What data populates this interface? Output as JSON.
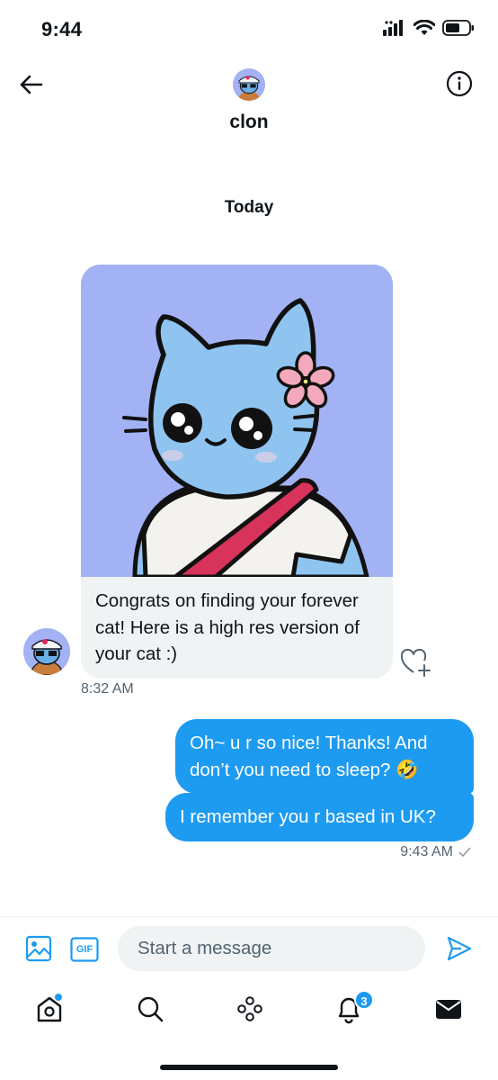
{
  "status_bar": {
    "time": "9:44"
  },
  "header": {
    "name": "clon"
  },
  "date_separator": "Today",
  "incoming_message": {
    "text": "Congrats on finding your forever cat! Here is a high res version of your cat :)",
    "time": "8:32 AM"
  },
  "outgoing_messages": [
    {
      "text": "Oh~ u r so nice! Thanks! And don’t you need to sleep? 🤣"
    },
    {
      "text": "I remember you r based in UK?"
    }
  ],
  "outgoing_time": "9:43 AM",
  "composer": {
    "placeholder": "Start a message",
    "gif_label": "GIF"
  },
  "bottom_nav": {
    "notifications_count": "3"
  },
  "colors": {
    "accent": "#1d9bf0",
    "image_bg": "#a2b2f4",
    "bubble_in": "#eff3f4"
  },
  "icons": [
    "back-arrow-icon",
    "info-icon",
    "image-icon",
    "gif-icon",
    "send-icon",
    "home-icon",
    "search-icon",
    "spaces-icon",
    "bell-icon",
    "mail-icon",
    "heart-plus-icon",
    "check-icon"
  ]
}
